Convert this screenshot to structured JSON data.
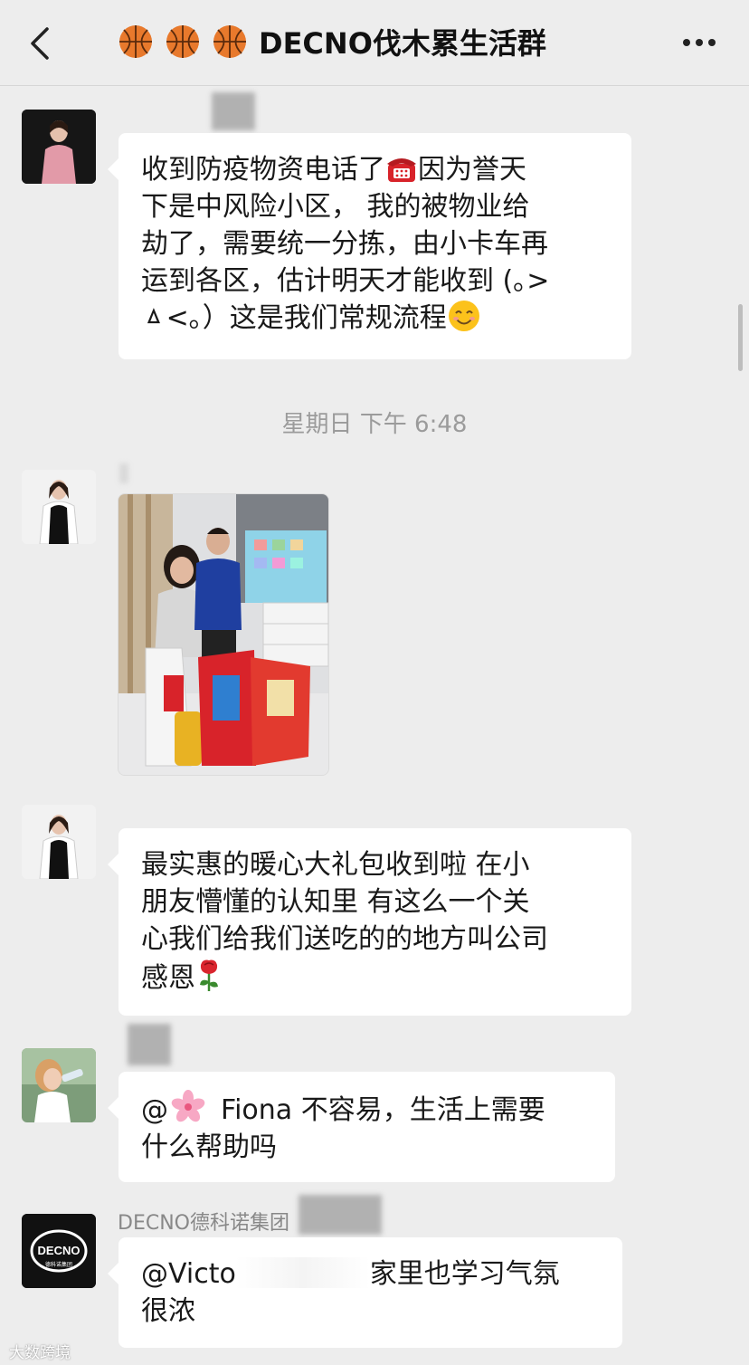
{
  "header": {
    "title": "DECNO伐木累生活群",
    "icons": [
      "basketball-emoji",
      "basketball-emoji",
      "basketball-emoji"
    ]
  },
  "messages": [
    {
      "type": "text",
      "lines": [
        "收到防疫物资电话了",
        "因为誉天",
        "下是中风险小区， 我的被物业给",
        "劫了，需要统一分拣，由小卡车再",
        "运到各区，估计明天才能收到 (｡>",
        "ㅿ<｡）这是我们常规流程"
      ],
      "emojis": [
        "telephone",
        "smiling-face"
      ]
    },
    {
      "type": "timestamp",
      "text": "星期日 下午 6:48"
    },
    {
      "type": "image",
      "description_icon": "photo-family-with-gifts"
    },
    {
      "type": "text",
      "lines": [
        "最实惠的暖心大礼包收到啦 在小",
        "朋友懵懂的认知里 有这么一个关",
        "心我们给我们送吃的的地方叫公司",
        " 感恩"
      ],
      "emojis": [
        "rose"
      ]
    },
    {
      "type": "text",
      "at": "@",
      "lines_a": "Fiona 不容易，生活上需要",
      "line2": "什么帮助吗",
      "emojis": [
        "cherry-blossom"
      ]
    },
    {
      "type": "text",
      "nickname": "DECNO德科诺集团",
      "part1": "@Victo",
      "part2": "家里也学习气氛",
      "line2": "很浓"
    }
  ],
  "avatar_logo": {
    "brand": "DECNO",
    "sub": "德科诺集团"
  },
  "watermark": "大数跨境",
  "colors": {
    "background": "#ededed",
    "bubble": "#ffffff",
    "text": "#191919",
    "timestamp": "#9b9b9b"
  }
}
